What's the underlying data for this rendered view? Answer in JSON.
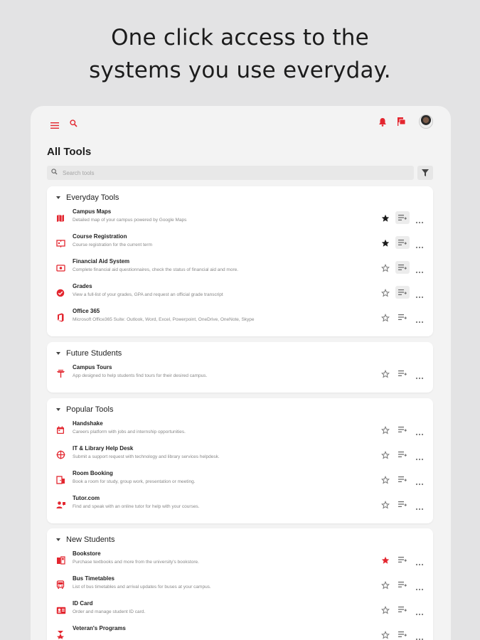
{
  "headline": {
    "line1": "One click access to the",
    "line2": "systems you use everyday."
  },
  "page_title": "All Tools",
  "search": {
    "placeholder": "Search tools"
  },
  "colors": {
    "accent": "#e3262f",
    "star_filled": "#1b1b1b",
    "icon_gray": "#777777"
  },
  "sections": [
    {
      "title": "Everyday Tools",
      "items": [
        {
          "name": "Campus Maps",
          "desc": "Detailed map of your campus powered by Google Maps",
          "icon": "map-icon",
          "star": "filled-dark",
          "list_active": true
        },
        {
          "name": "Course Registration",
          "desc": "Course registration for the current term",
          "icon": "book-icon",
          "star": "filled-dark",
          "list_active": true
        },
        {
          "name": "Financial Aid System",
          "desc": "Complete financial aid questionnaires, check the status of financial aid and more.",
          "icon": "money-icon",
          "star": "outline",
          "list_active": true
        },
        {
          "name": "Grades",
          "desc": "View a full-list of your grades, GPA and request an official grade transcript",
          "icon": "check-circle-icon",
          "star": "outline",
          "list_active": true
        },
        {
          "name": "Office 365",
          "desc": "Microsoft Office365 Suite: Outlook, Word, Excel, Powerpoint, OneDrive, OneNote, Skype",
          "icon": "office-icon",
          "star": "outline",
          "list_active": false
        }
      ]
    },
    {
      "title": "Future Students",
      "items": [
        {
          "name": "Campus Tours",
          "desc": "App designed to help students find tours for their desired campus.",
          "icon": "tour-icon",
          "star": "outline",
          "list_active": false
        }
      ]
    },
    {
      "title": "Popular Tools",
      "items": [
        {
          "name": "Handshake",
          "desc": "Careers platform with jobs and internship opportunities.",
          "icon": "calendar-icon",
          "star": "outline",
          "list_active": false
        },
        {
          "name": "IT & Library Help Desk",
          "desc": "Submit a support request with technology and library services helpdesk.",
          "icon": "helpdesk-icon",
          "star": "outline",
          "list_active": false
        },
        {
          "name": "Room Booking",
          "desc": "Book a room for study, group work, presentation or meeting.",
          "icon": "room-icon",
          "star": "outline",
          "list_active": false
        },
        {
          "name": "Tutor.com",
          "desc": "Find and speak with an online tutor for help with your courses.",
          "icon": "tutor-icon",
          "star": "outline",
          "list_active": false
        }
      ]
    },
    {
      "title": "New Students",
      "items": [
        {
          "name": "Bookstore",
          "desc": "Purchase textbooks and more from the university's bookstore.",
          "icon": "bookstore-icon",
          "star": "filled-red",
          "list_active": false
        },
        {
          "name": "Bus Timetables",
          "desc": "List of bus timetables and arrival updates for buses at your campus.",
          "icon": "bus-icon",
          "star": "outline",
          "list_active": false
        },
        {
          "name": "ID Card",
          "desc": "Order and manage student ID card.",
          "icon": "id-card-icon",
          "star": "outline",
          "list_active": false
        },
        {
          "name": "Veteran's Programs",
          "desc": "",
          "icon": "veteran-icon",
          "star": "outline",
          "list_active": false
        }
      ]
    }
  ]
}
